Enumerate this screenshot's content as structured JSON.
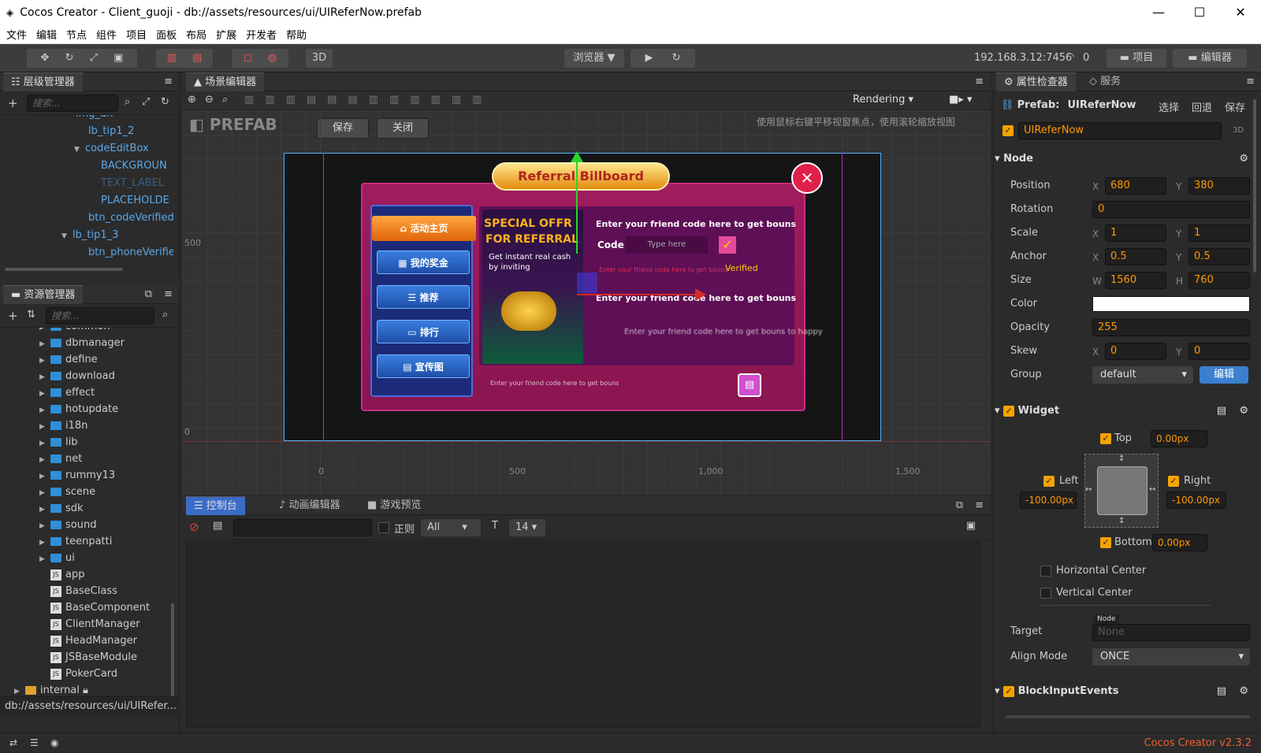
{
  "window": {
    "title": "Cocos Creator - Client_guoji - db://assets/resources/ui/UIReferNow.prefab",
    "minimize": "—",
    "maximize": "☐",
    "close": "✕"
  },
  "menu": [
    "文件",
    "编辑",
    "节点",
    "组件",
    "项目",
    "面板",
    "布局",
    "扩展",
    "开发者",
    "帮助"
  ],
  "toolbar": {
    "mode3d": "3D",
    "browser": "浏览器 ▼",
    "ip": "192.168.3.12:7456",
    "count": "0",
    "project": "项目",
    "editor": "编辑器"
  },
  "hierarchy": {
    "tab": "层级管理器",
    "search_placeholder": "搜索...",
    "items": [
      {
        "label": "img_dh",
        "level": 1
      },
      {
        "label": "lb_tip1_2",
        "level": 1
      },
      {
        "label": "codeEditBox",
        "level": 1,
        "expanded": true
      },
      {
        "label": "BACKGROUN",
        "level": 2
      },
      {
        "label": "TEXT_LABEL",
        "level": 2,
        "dim": true
      },
      {
        "label": "PLACEHOLDE",
        "level": 2
      },
      {
        "label": "btn_codeVerified",
        "level": 1
      },
      {
        "label": "lb_tip1_3",
        "level": 0,
        "expanded": true
      },
      {
        "label": "btn_phoneVerifie",
        "level": 1
      }
    ]
  },
  "assets": {
    "tab": "资源管理器",
    "search_placeholder": "搜索...",
    "items": [
      {
        "label": "common",
        "type": "folder"
      },
      {
        "label": "dbmanager",
        "type": "folder"
      },
      {
        "label": "define",
        "type": "folder"
      },
      {
        "label": "download",
        "type": "folder"
      },
      {
        "label": "effect",
        "type": "folder"
      },
      {
        "label": "hotupdate",
        "type": "folder"
      },
      {
        "label": "i18n",
        "type": "folder"
      },
      {
        "label": "lib",
        "type": "folder"
      },
      {
        "label": "net",
        "type": "folder"
      },
      {
        "label": "rummy13",
        "type": "folder"
      },
      {
        "label": "scene",
        "type": "folder"
      },
      {
        "label": "sdk",
        "type": "folder"
      },
      {
        "label": "sound",
        "type": "folder"
      },
      {
        "label": "teenpatti",
        "type": "folder"
      },
      {
        "label": "ui",
        "type": "folder"
      },
      {
        "label": "app",
        "type": "js"
      },
      {
        "label": "BaseClass",
        "type": "js"
      },
      {
        "label": "BaseComponent",
        "type": "js"
      },
      {
        "label": "ClientManager",
        "type": "js"
      },
      {
        "label": "HeadManager",
        "type": "js"
      },
      {
        "label": "JSBaseModule",
        "type": "js"
      },
      {
        "label": "PokerCard",
        "type": "js"
      }
    ],
    "internal": "internal",
    "path": "db://assets/resources/ui/UIRefer..."
  },
  "scene": {
    "tab": "场景编辑器",
    "rendering": "Rendering",
    "prefab_logo": "PREFAB",
    "save": "保存",
    "close": "关闭",
    "hint": "使用鼠标右键平移视窗焦点，使用滚轮缩放视图",
    "axis_x": [
      "0",
      "500",
      "1,000",
      "1,500"
    ],
    "axis_y": [
      "500",
      "0"
    ],
    "game": {
      "title": "Referral Billboard",
      "menu": [
        "活动主页",
        "我的奖金",
        "推荐",
        "排行",
        "宣传图"
      ],
      "promo_title1": "SPECIAL OFFR",
      "promo_title2": "FOR REFERRAL",
      "promo_sub": "Get instant real cash by inviting",
      "enter_code": "Enter your friend code here to get bouns",
      "code_label": "Code",
      "code_placeholder": "Type here",
      "small_tip": "Enter your friend code here to get bouns",
      "verified": "Verified",
      "enter_code2": "Enter your friend code here to get bouns",
      "blur_text": "Enter your friend code here to get bouns to happy",
      "footer_text": "Enter your friend code here to get bouns"
    }
  },
  "console": {
    "tabs": [
      "控制台",
      "动画编辑器",
      "游戏预览"
    ],
    "regex": "正则",
    "filter": "All",
    "font_size": "14"
  },
  "inspector": {
    "tab": "属性检查器",
    "tab2": "服务",
    "prefab_label": "Prefab:",
    "prefab_name": "UIReferNow",
    "actions": [
      "选择",
      "回退",
      "保存"
    ],
    "node_name": "UIReferNow",
    "badge3d": "3D",
    "node_section": "Node",
    "props": {
      "position": {
        "label": "Position",
        "x": "680",
        "y": "380"
      },
      "rotation": {
        "label": "Rotation",
        "value": "0"
      },
      "scale": {
        "label": "Scale",
        "x": "1",
        "y": "1"
      },
      "anchor": {
        "label": "Anchor",
        "x": "0.5",
        "y": "0.5"
      },
      "size": {
        "label": "Size",
        "w": "1560",
        "h": "760"
      },
      "color": {
        "label": "Color",
        "hex": "#ffffff"
      },
      "opacity": {
        "label": "Opacity",
        "value": "255"
      },
      "skew": {
        "label": "Skew",
        "x": "0",
        "y": "0"
      },
      "group": {
        "label": "Group",
        "value": "default",
        "edit": "编辑"
      }
    },
    "axis": {
      "x": "X",
      "y": "Y",
      "w": "W",
      "h": "H"
    },
    "widget": {
      "section": "Widget",
      "top": "Top",
      "top_val": "0.00px",
      "left": "Left",
      "left_val": "-100.00px",
      "right": "Right",
      "right_val": "-100.00px",
      "bottom": "Bottom",
      "bottom_val": "0.00px",
      "hcenter": "Horizontal Center",
      "vcenter": "Vertical Center",
      "target": "Target",
      "target_tag": "Node",
      "target_val": "None",
      "align_mode": "Align Mode",
      "align_val": "ONCE"
    },
    "block": "BlockInputEvents"
  },
  "status": {
    "version": "Cocos Creator v2.3.2"
  },
  "colors": {
    "accent": "#f7a300",
    "selection_blue": "#2f8fd8",
    "dark_bg": "#2b2b2b",
    "panel_bg": "#3c3c3c"
  }
}
